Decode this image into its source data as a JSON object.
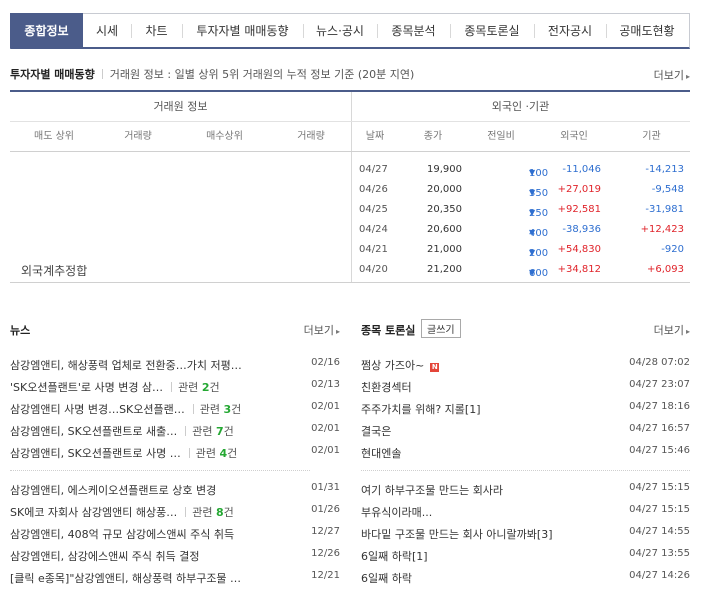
{
  "tabs": [
    {
      "label": "종합정보",
      "active": true
    },
    {
      "label": "시세"
    },
    {
      "label": "차트"
    },
    {
      "label": "투자자별 매매동향"
    },
    {
      "label": "뉴스·공시"
    },
    {
      "label": "종목분석"
    },
    {
      "label": "종목토론실"
    },
    {
      "label": "전자공시"
    },
    {
      "label": "공매도현황"
    }
  ],
  "investor": {
    "title": "투자자별 매매동향",
    "desc": "거래원 정보 : 일별 상위 5위 거래원의 누적 정보 기준 (20분 지연)",
    "more": "더보기",
    "broker_group": "거래원 정보",
    "foreign_group": "외국인 ·기관",
    "broker_cols": [
      "매도 상위",
      "거래량",
      "매수상위",
      "거래량"
    ],
    "foreign_cols": [
      "날짜",
      "종가",
      "전일비",
      "외국인",
      "기관"
    ],
    "foreign_total": "외국계추정합",
    "rows": [
      {
        "date": "04/27",
        "price": "19,900",
        "change": "100",
        "foreign": "-11,046",
        "inst": "-14,213"
      },
      {
        "date": "04/26",
        "price": "20,000",
        "change": "350",
        "foreign": "+27,019",
        "inst": "-9,548"
      },
      {
        "date": "04/25",
        "price": "20,350",
        "change": "250",
        "foreign": "+92,581",
        "inst": "-31,981"
      },
      {
        "date": "04/24",
        "price": "20,600",
        "change": "400",
        "foreign": "-38,936",
        "inst": "+12,423"
      },
      {
        "date": "04/21",
        "price": "21,000",
        "change": "200",
        "foreign": "+54,830",
        "inst": "-920"
      },
      {
        "date": "04/20",
        "price": "21,200",
        "change": "600",
        "foreign": "+34,812",
        "inst": "+6,093"
      }
    ]
  },
  "news": {
    "title": "뉴스",
    "more": "더보기",
    "related_label": "관련",
    "related_suffix": "건",
    "group1": [
      {
        "title": "삼강엠앤티, 해상풍력 업체로 전환중…가치 저평…",
        "date": "02/16"
      },
      {
        "title": "'SK오션플랜트'로 사명 변경 삼…",
        "date": "02/13",
        "related": "2"
      },
      {
        "title": "삼강엠앤티 사명 변경…SK오션플랜…",
        "date": "02/01",
        "related": "3"
      },
      {
        "title": "삼강엠앤티, SK오션플랜트로 새출…",
        "date": "02/01",
        "related": "7"
      },
      {
        "title": "삼강엠앤티, SK오션플랜트로 사명 …",
        "date": "02/01",
        "related": "4"
      }
    ],
    "group2": [
      {
        "title": "삼강엠앤티, 에스케이오션플랜트로 상호 변경",
        "date": "01/31"
      },
      {
        "title": "SK에코 자회사 삼강엠앤티 해상풍…",
        "date": "01/26",
        "related": "8"
      },
      {
        "title": "삼강엠앤티, 408억 규모 삼강에스앤씨 주식 취득",
        "date": "12/27"
      },
      {
        "title": "삼강엠앤티, 삼강에스앤씨 주식 취득 결정",
        "date": "12/26"
      },
      {
        "title": "[클릭 e종목]\"삼강엠앤티, 해상풍력 하부구조물 …",
        "date": "12/21"
      }
    ]
  },
  "board": {
    "title": "종목 토론실",
    "write": "글쓰기",
    "more": "더보기",
    "new_badge": "N",
    "group1": [
      {
        "title": "쩜상 가즈아~",
        "date": "04/28 07:02",
        "is_new": true
      },
      {
        "title": "친환경섹터",
        "date": "04/27 23:07"
      },
      {
        "title": "주주가치를 위해? 지롤[1]",
        "date": "04/27 18:16"
      },
      {
        "title": "결국은",
        "date": "04/27 16:57"
      },
      {
        "title": "현대엔솔",
        "date": "04/27 15:46"
      }
    ],
    "group2": [
      {
        "title": "여기 하부구조물 만드는 회사라",
        "date": "04/27 15:15"
      },
      {
        "title": "부유식이라매...",
        "date": "04/27 15:15"
      },
      {
        "title": "바다밑 구조물 만드는 회사 아니랄까봐[3]",
        "date": "04/27 14:55"
      },
      {
        "title": "6일째 하락[1]",
        "date": "04/27 13:55"
      },
      {
        "title": "6일째 하락",
        "date": "04/27 14:26"
      }
    ]
  },
  "colors": {
    "accent": "#4b5c8a",
    "up": "#e0242b",
    "down": "#2f6fd0",
    "related_count": "#25a833"
  }
}
